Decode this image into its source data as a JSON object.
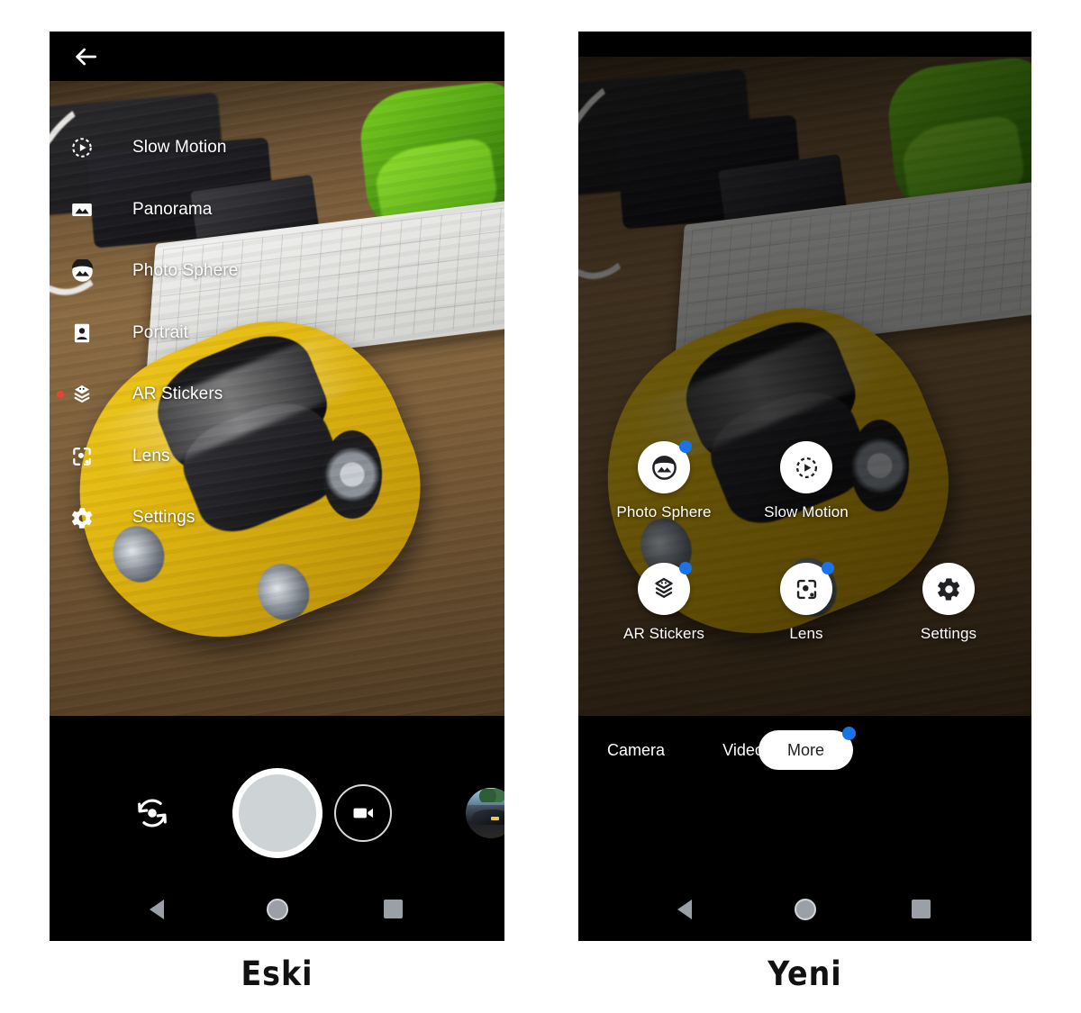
{
  "comparison": {
    "left_caption": "Eski",
    "right_caption": "Yeni"
  },
  "old_ui": {
    "back_button": "back-arrow",
    "menu_items": [
      {
        "label": "Slow Motion",
        "icon": "slow-motion-icon",
        "badge": false
      },
      {
        "label": "Panorama",
        "icon": "panorama-icon",
        "badge": false
      },
      {
        "label": "Photo Sphere",
        "icon": "photo-sphere-icon",
        "badge": false
      },
      {
        "label": "Portrait",
        "icon": "portrait-icon",
        "badge": false
      },
      {
        "label": "AR Stickers",
        "icon": "ar-stickers-icon",
        "badge": true
      },
      {
        "label": "Lens",
        "icon": "lens-icon",
        "badge": true
      },
      {
        "label": "Settings",
        "icon": "settings-icon",
        "badge": false
      }
    ],
    "controls": {
      "flip_camera": "flip-camera-icon",
      "shutter": "shutter-button",
      "video": "video-camera-icon",
      "thumbnail": "gallery-thumbnail"
    }
  },
  "new_ui": {
    "modes": [
      {
        "label": "Photo Sphere",
        "icon": "photo-sphere-icon",
        "badge": true
      },
      {
        "label": "Slow Motion",
        "icon": "slow-motion-icon",
        "badge": false
      },
      {
        "label": "AR Stickers",
        "icon": "ar-stickers-icon",
        "badge": true
      },
      {
        "label": "Lens",
        "icon": "lens-icon",
        "badge": true
      },
      {
        "label": "Settings",
        "icon": "settings-icon",
        "badge": false
      }
    ],
    "tabs": [
      {
        "label": "Camera",
        "selected": false,
        "badge": false
      },
      {
        "label": "Video",
        "selected": false,
        "badge": false
      },
      {
        "label": "More",
        "selected": true,
        "badge": true
      }
    ]
  },
  "navbar": {
    "back": "nav-back-icon",
    "home": "nav-home-icon",
    "recents": "nav-recents-icon"
  },
  "colors": {
    "badge_blue": "#1a73e8",
    "badge_red": "#ea4335",
    "chrome_black": "#000000",
    "text_white": "#ffffff"
  }
}
